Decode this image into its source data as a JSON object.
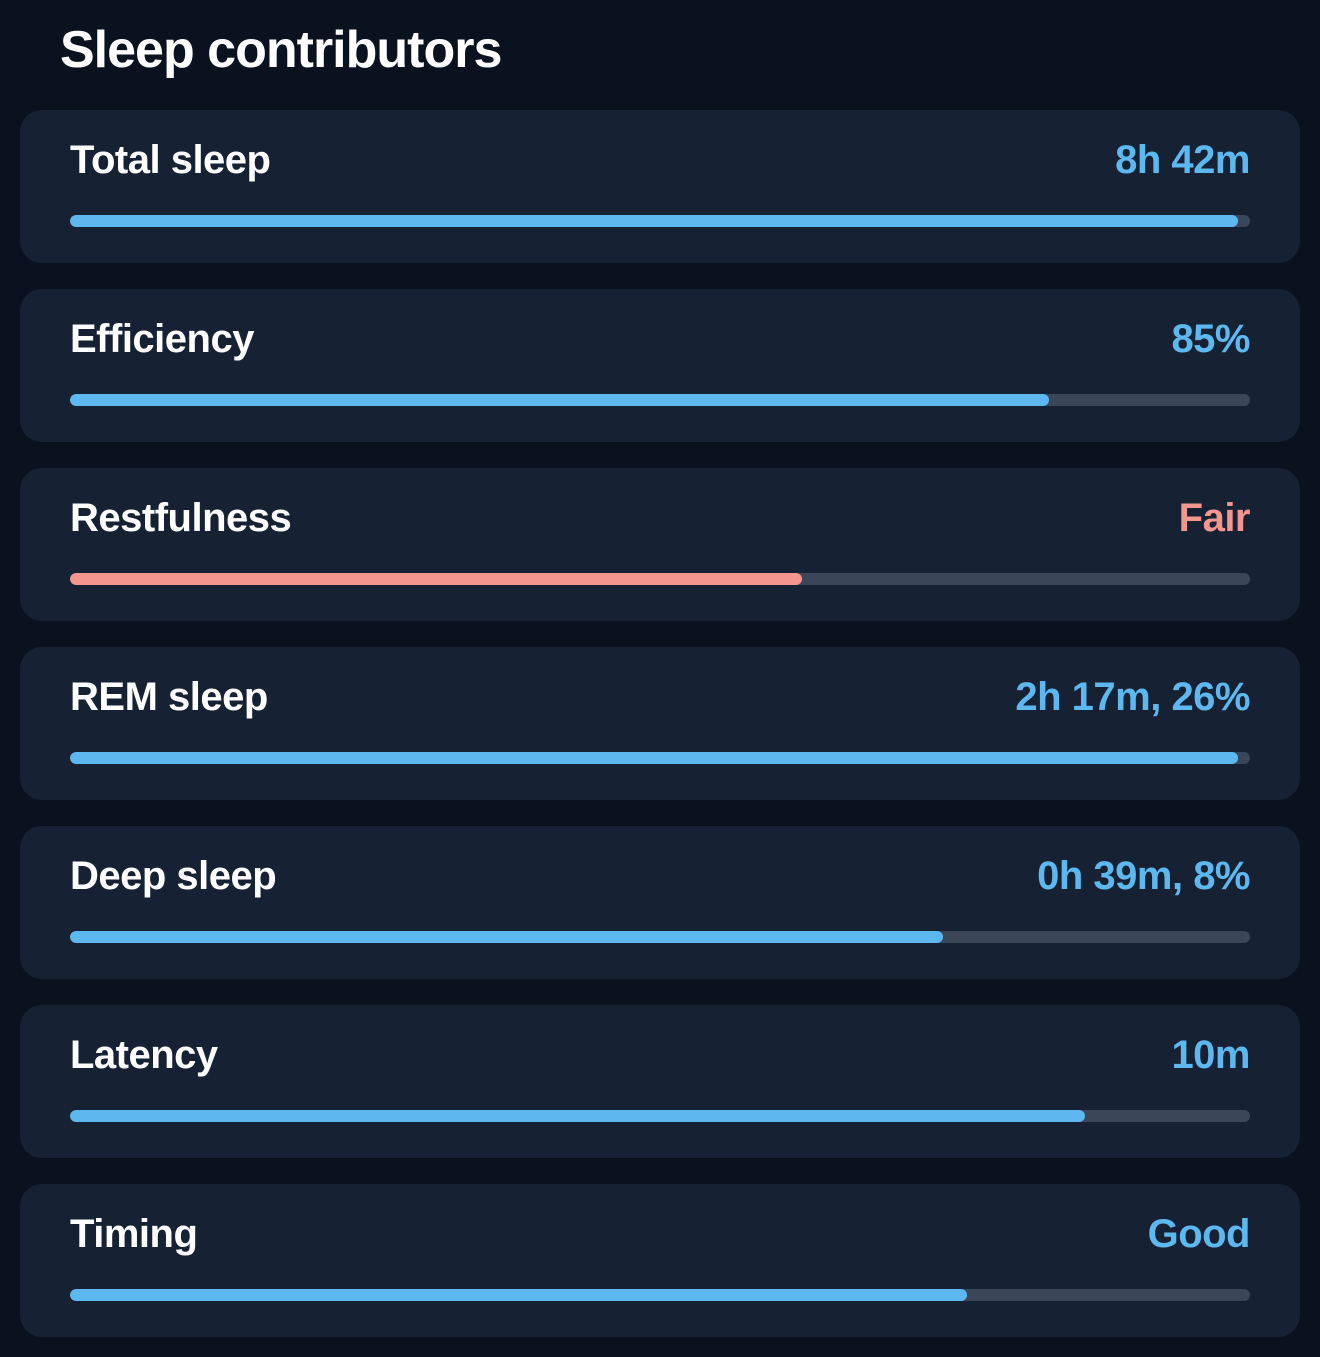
{
  "title": "Sleep contributors",
  "items": [
    {
      "label": "Total sleep",
      "value": "8h 42m",
      "progress": 99,
      "status": "good"
    },
    {
      "label": "Efficiency",
      "value": "85%",
      "progress": 83,
      "status": "good"
    },
    {
      "label": "Restfulness",
      "value": "Fair",
      "progress": 62,
      "status": "fair"
    },
    {
      "label": "REM sleep",
      "value": "2h 17m, 26%",
      "progress": 99,
      "status": "good"
    },
    {
      "label": "Deep sleep",
      "value": "0h 39m, 8%",
      "progress": 74,
      "status": "good"
    },
    {
      "label": "Latency",
      "value": "10m",
      "progress": 86,
      "status": "good"
    },
    {
      "label": "Timing",
      "value": "Good",
      "progress": 76,
      "status": "good"
    }
  ]
}
